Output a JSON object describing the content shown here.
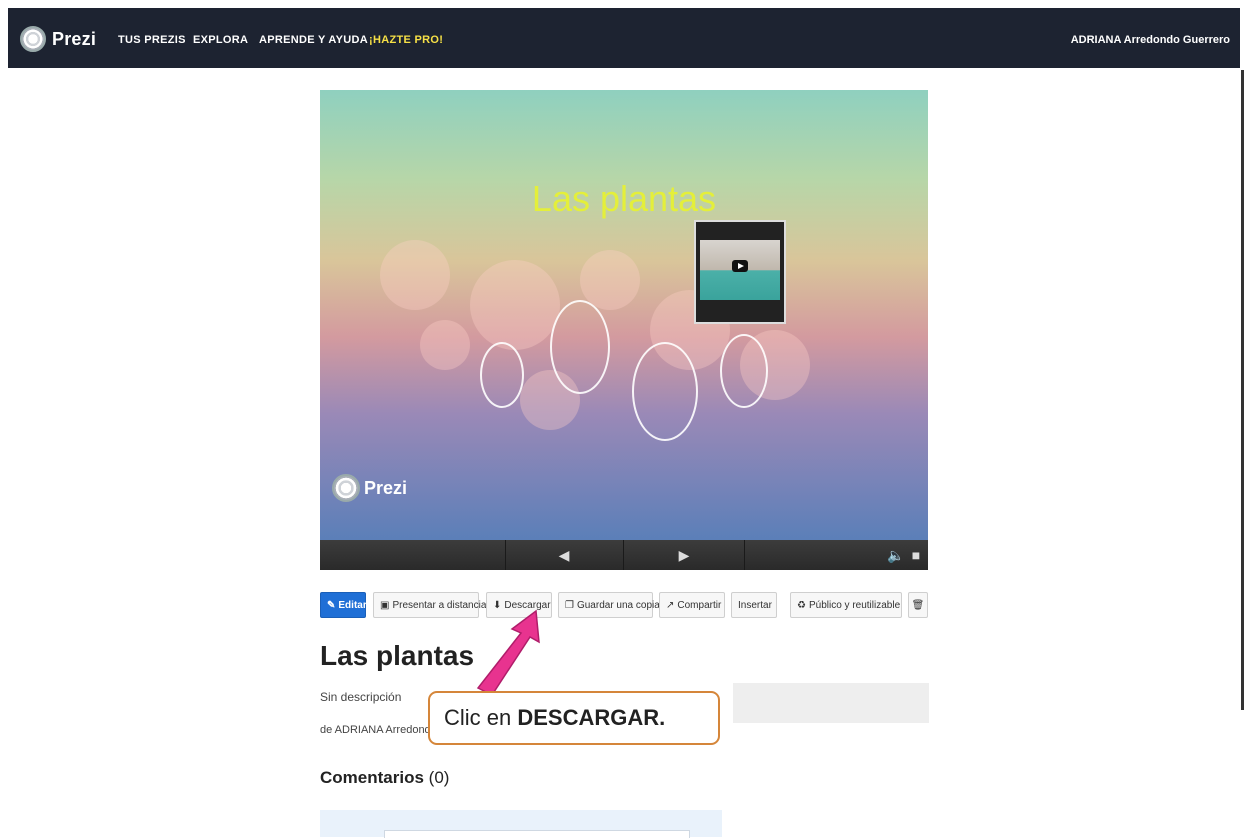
{
  "topbar": {
    "logo_text": "Prezi",
    "nav": [
      "TUS PREZIS",
      "EXPLORA",
      "APRENDE Y AYUDA",
      "¡HAZTE PRO!"
    ],
    "user_name": "ADRIANA Arredondo Guerrero"
  },
  "viewer": {
    "slide_title": "Las plantas",
    "watermark": "Prezi",
    "controls": {
      "prev_icon": "arrow-left-icon",
      "next_icon": "arrow-right-icon",
      "volume_icon": "volume-icon",
      "fullscreen_icon": "fullscreen-icon"
    }
  },
  "toolbar": {
    "edit": "Editar",
    "present_remote": "Presentar a distancia",
    "download": "Descargar",
    "save_copy": "Guardar una copia",
    "share": "Compartir",
    "embed": "Insertar",
    "visibility": "Público y reutilizable",
    "delete_icon": "trash-icon"
  },
  "details": {
    "title": "Las plantas",
    "description": "Sin descripción",
    "author": "de ADRIANA Arredondo",
    "comments_label": "Comentarios",
    "comments_count": "(0)"
  },
  "annotation": {
    "text_prefix": "Clic en ",
    "text_bold": "DESCARGAR.",
    "arrow_color": "#e8338f",
    "border_color": "#d5863a"
  },
  "colors": {
    "nav_bg": "#1d2331",
    "pro": "#f6e046",
    "primary": "#1f6fd6",
    "slide_title": "#e4ef3a"
  }
}
